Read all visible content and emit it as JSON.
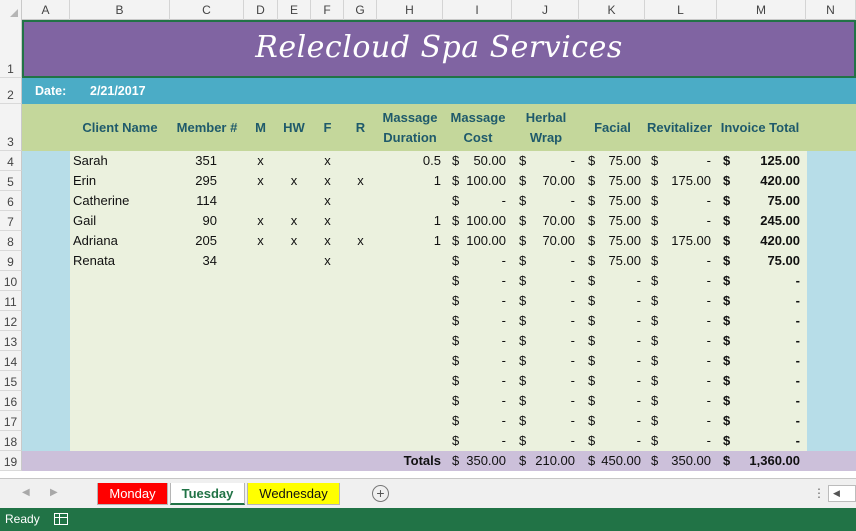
{
  "columns": [
    "A",
    "B",
    "C",
    "D",
    "E",
    "F",
    "G",
    "H",
    "I",
    "J",
    "K",
    "L",
    "M",
    "N"
  ],
  "rows": [
    "1",
    "2",
    "3",
    "4",
    "5",
    "6",
    "7",
    "8",
    "9",
    "10",
    "11",
    "12",
    "13",
    "14",
    "15",
    "16",
    "17",
    "18",
    "19"
  ],
  "title": "Relecloud Spa Services",
  "date_label": "Date:",
  "date_value": "2/21/2017",
  "headers": {
    "client": "Client Name",
    "member": "Member #",
    "m": "M",
    "hw": "HW",
    "f": "F",
    "r": "R",
    "massage_duration": "Massage Duration",
    "massage_cost": "Massage Cost",
    "herbal_wrap": "Herbal Wrap",
    "facial": "Facial",
    "revitalizer": "Revitalizer",
    "invoice_total": "Invoice Total"
  },
  "currency_symbol": "$",
  "records": [
    {
      "client": "Sarah",
      "member": "351",
      "m": "x",
      "hw": "",
      "f": "x",
      "r": "",
      "duration": "0.5",
      "massage": "50.00",
      "herbal": "-",
      "facial": "75.00",
      "revital": "-",
      "total": "125.00"
    },
    {
      "client": "Erin",
      "member": "295",
      "m": "x",
      "hw": "x",
      "f": "x",
      "r": "x",
      "duration": "1",
      "massage": "100.00",
      "herbal": "70.00",
      "facial": "75.00",
      "revital": "175.00",
      "total": "420.00"
    },
    {
      "client": "Catherine",
      "member": "114",
      "m": "",
      "hw": "",
      "f": "x",
      "r": "",
      "duration": "",
      "massage": "-",
      "herbal": "-",
      "facial": "75.00",
      "revital": "-",
      "total": "75.00"
    },
    {
      "client": "Gail",
      "member": "90",
      "m": "x",
      "hw": "x",
      "f": "x",
      "r": "",
      "duration": "1",
      "massage": "100.00",
      "herbal": "70.00",
      "facial": "75.00",
      "revital": "-",
      "total": "245.00"
    },
    {
      "client": "Adriana",
      "member": "205",
      "m": "x",
      "hw": "x",
      "f": "x",
      "r": "x",
      "duration": "1",
      "massage": "100.00",
      "herbal": "70.00",
      "facial": "75.00",
      "revital": "175.00",
      "total": "420.00"
    },
    {
      "client": "Renata",
      "member": "34",
      "m": "",
      "hw": "",
      "f": "x",
      "r": "",
      "duration": "",
      "massage": "-",
      "herbal": "-",
      "facial": "75.00",
      "revital": "-",
      "total": "75.00"
    },
    {
      "client": "",
      "member": "",
      "m": "",
      "hw": "",
      "f": "",
      "r": "",
      "duration": "",
      "massage": "-",
      "herbal": "-",
      "facial": "-",
      "revital": "-",
      "total": "-"
    },
    {
      "client": "",
      "member": "",
      "m": "",
      "hw": "",
      "f": "",
      "r": "",
      "duration": "",
      "massage": "-",
      "herbal": "-",
      "facial": "-",
      "revital": "-",
      "total": "-"
    },
    {
      "client": "",
      "member": "",
      "m": "",
      "hw": "",
      "f": "",
      "r": "",
      "duration": "",
      "massage": "-",
      "herbal": "-",
      "facial": "-",
      "revital": "-",
      "total": "-"
    },
    {
      "client": "",
      "member": "",
      "m": "",
      "hw": "",
      "f": "",
      "r": "",
      "duration": "",
      "massage": "-",
      "herbal": "-",
      "facial": "-",
      "revital": "-",
      "total": "-"
    },
    {
      "client": "",
      "member": "",
      "m": "",
      "hw": "",
      "f": "",
      "r": "",
      "duration": "",
      "massage": "-",
      "herbal": "-",
      "facial": "-",
      "revital": "-",
      "total": "-"
    },
    {
      "client": "",
      "member": "",
      "m": "",
      "hw": "",
      "f": "",
      "r": "",
      "duration": "",
      "massage": "-",
      "herbal": "-",
      "facial": "-",
      "revital": "-",
      "total": "-"
    },
    {
      "client": "",
      "member": "",
      "m": "",
      "hw": "",
      "f": "",
      "r": "",
      "duration": "",
      "massage": "-",
      "herbal": "-",
      "facial": "-",
      "revital": "-",
      "total": "-"
    },
    {
      "client": "",
      "member": "",
      "m": "",
      "hw": "",
      "f": "",
      "r": "",
      "duration": "",
      "massage": "-",
      "herbal": "-",
      "facial": "-",
      "revital": "-",
      "total": "-"
    },
    {
      "client": "",
      "member": "",
      "m": "",
      "hw": "",
      "f": "",
      "r": "",
      "duration": "",
      "massage": "-",
      "herbal": "-",
      "facial": "-",
      "revital": "-",
      "total": "-"
    }
  ],
  "totals": {
    "label": "Totals",
    "massage": "350.00",
    "herbal": "210.00",
    "facial": "450.00",
    "revital": "350.00",
    "total": "1,360.00"
  },
  "sheet_tabs": [
    {
      "label": "Monday",
      "color": "#ff0000"
    },
    {
      "label": "Tuesday",
      "color": "#ffffff"
    },
    {
      "label": "Wednesday",
      "color": "#ffff00"
    }
  ],
  "status": "Ready",
  "colors": {
    "title_band": "#8064a2",
    "date_band": "#4bacc6",
    "header_band": "#c4d79b",
    "body_fill": "#ebf1de",
    "side_strip": "#b7dde8",
    "totals_band": "#ccc0da",
    "excel_green": "#217346"
  }
}
